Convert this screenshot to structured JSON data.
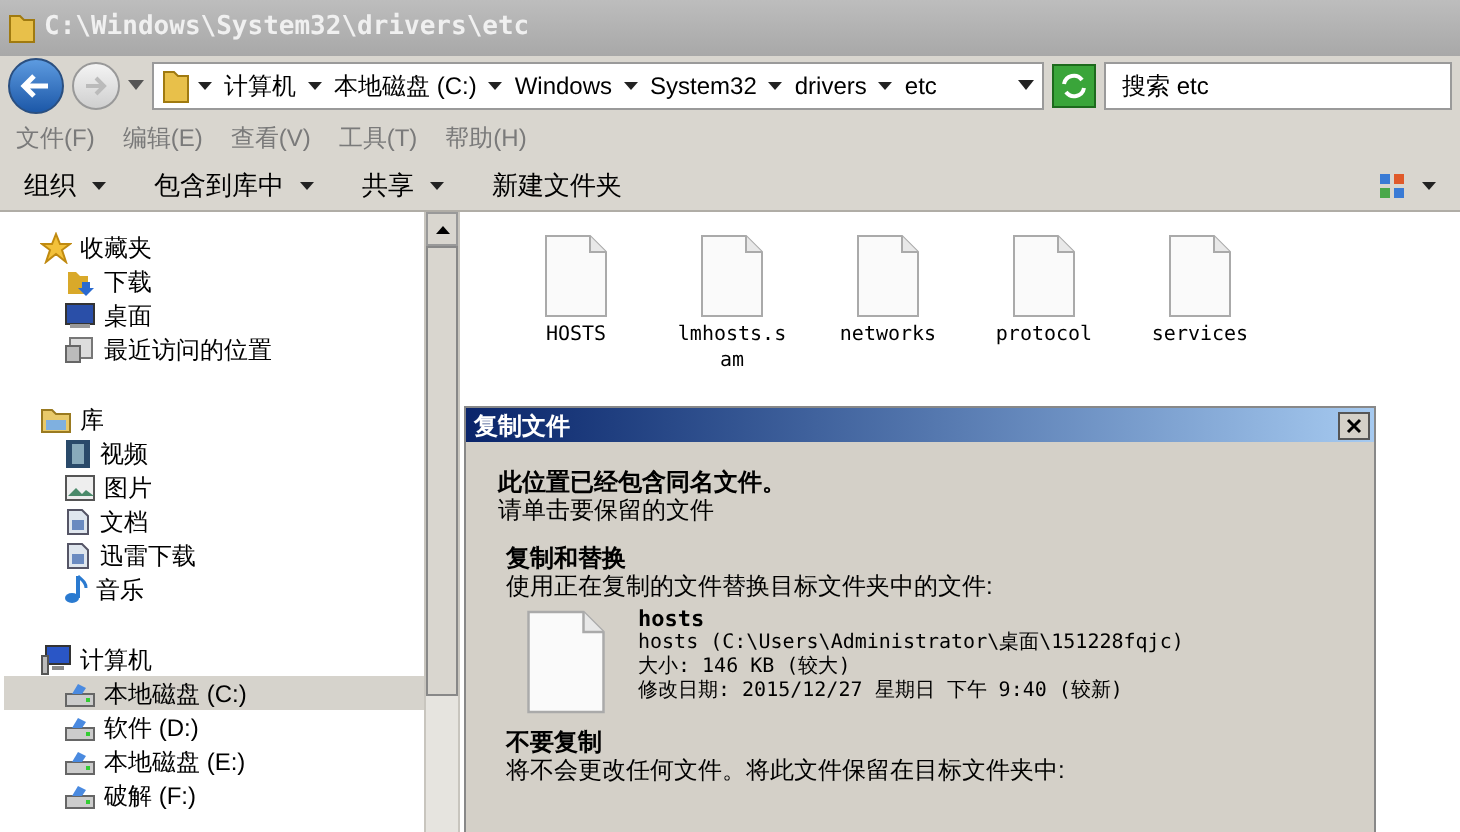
{
  "window": {
    "title": "C:\\Windows\\System32\\drivers\\etc"
  },
  "address": {
    "breadcrumbs": [
      "计算机",
      "本地磁盘 (C:)",
      "Windows",
      "System32",
      "drivers",
      "etc"
    ]
  },
  "search": {
    "placeholder": "搜索 etc"
  },
  "menu": [
    "文件(F)",
    "编辑(E)",
    "查看(V)",
    "工具(T)",
    "帮助(H)"
  ],
  "toolbar": [
    {
      "label": "组织",
      "dropdown": true
    },
    {
      "label": "包含到库中",
      "dropdown": true
    },
    {
      "label": "共享",
      "dropdown": true
    },
    {
      "label": "新建文件夹",
      "dropdown": false
    }
  ],
  "sidebar": {
    "groups": [
      {
        "label": "收藏夹",
        "kind": "favorites",
        "children": [
          {
            "label": "下载",
            "kind": "download",
            "selected": false
          },
          {
            "label": "桌面",
            "kind": "desktop",
            "selected": false
          },
          {
            "label": "最近访问的位置",
            "kind": "recent",
            "selected": false
          }
        ]
      },
      {
        "label": "库",
        "kind": "library",
        "children": [
          {
            "label": "视频",
            "kind": "video",
            "selected": false
          },
          {
            "label": "图片",
            "kind": "picture",
            "selected": false
          },
          {
            "label": "文档",
            "kind": "document",
            "selected": false
          },
          {
            "label": "迅雷下载",
            "kind": "document",
            "selected": false
          },
          {
            "label": "音乐",
            "kind": "music",
            "selected": false
          }
        ]
      },
      {
        "label": "计算机",
        "kind": "computer",
        "children": [
          {
            "label": "本地磁盘 (C:)",
            "kind": "drive",
            "selected": true
          },
          {
            "label": "软件 (D:)",
            "kind": "drive",
            "selected": false
          },
          {
            "label": "本地磁盘 (E:)",
            "kind": "drive",
            "selected": false
          },
          {
            "label": "破解 (F:)",
            "kind": "drive",
            "selected": false
          }
        ]
      }
    ]
  },
  "files": [
    "HOSTS",
    "lmhosts.sam",
    "networks",
    "protocol",
    "services"
  ],
  "dialog": {
    "title": "复制文件",
    "heading": "此位置已经包含同名文件。",
    "subheading": "请单击要保留的文件",
    "options": [
      {
        "title": "复制和替换",
        "description": "使用正在复制的文件替换目标文件夹中的文件:",
        "file": {
          "name": "hosts",
          "lines": [
            "hosts (C:\\Users\\Administrator\\桌面\\151228fqjc)",
            "大小: 146 KB (较大)",
            "修改日期: 2015/12/27 星期日 下午 9:40 (较新)"
          ]
        }
      },
      {
        "title": "不要复制",
        "description": "将不会更改任何文件。将此文件保留在目标文件夹中:"
      }
    ]
  }
}
